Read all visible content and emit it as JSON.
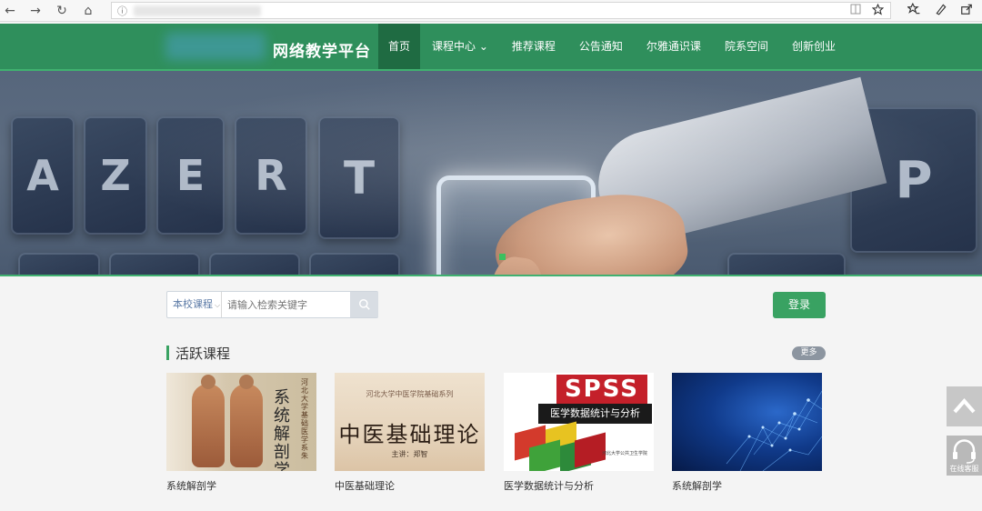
{
  "browser": {
    "back": "←",
    "forward": "→",
    "reload": "↻",
    "home": "⌂",
    "info": "ⓘ"
  },
  "site": {
    "title": "网络教学平台",
    "nav": [
      {
        "label": "首页",
        "active": true
      },
      {
        "label": "课程中心 ⌄",
        "active": false
      },
      {
        "label": "推荐课程",
        "active": false
      },
      {
        "label": "公告通知",
        "active": false
      },
      {
        "label": "尔雅通识课",
        "active": false
      },
      {
        "label": "院系空间",
        "active": false
      },
      {
        "label": "创新创业",
        "active": false
      }
    ]
  },
  "banner": {
    "keys": [
      "A",
      "Z",
      "E",
      "R",
      "T",
      "P"
    ]
  },
  "search": {
    "scope": "本校课程",
    "placeholder": "请输入检索关键字"
  },
  "login_label": "登录",
  "section": {
    "title": "活跃课程",
    "more": "更多"
  },
  "courses": [
    {
      "title": "系统解剖学",
      "cover_calligraphy": "系统解剖学",
      "cover_side": "河北大学基础医学系 朱"
    },
    {
      "title": "中医基础理论",
      "cover_sub": "河北大学中医学院基础系列",
      "cover_main": "中医基础理论",
      "cover_author": "主讲：郑智"
    },
    {
      "title": "医学数据统计与分析",
      "cover_logo": "SPSS",
      "cover_band": "医学数据统计与分析",
      "cover_caption": "河北大学公共卫生学院"
    },
    {
      "title": "系统解剖学"
    }
  ],
  "float": {
    "back_to_top": "回到顶部",
    "chat": "在线客服"
  },
  "colors": {
    "header": "#2f8f5c",
    "active_nav": "#1f6b42",
    "accent": "#39a262"
  }
}
